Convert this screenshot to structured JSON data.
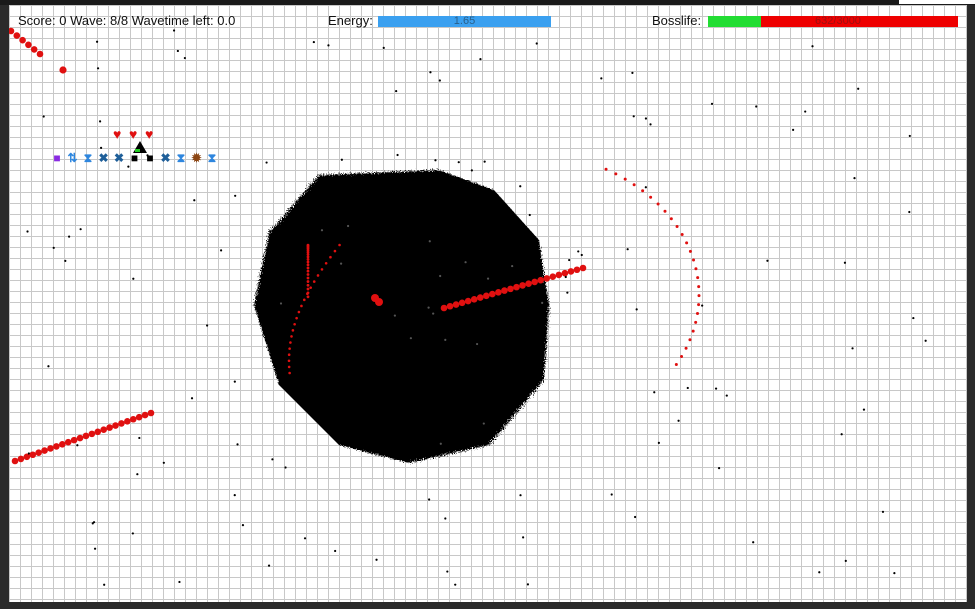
{
  "hud": {
    "score_label": "Score:",
    "score_value": "0",
    "wave_label": "Wave:",
    "wave_value": "8/8",
    "wavetime_label": "Wavetime left:",
    "wavetime_value": "0.0",
    "energy_label": "Energy:",
    "energy_value": "1.65",
    "energy_fill_fraction": 1.0,
    "bosslife_label": "Bosslife:",
    "bosslife_value": "632/3000",
    "bosslife_fraction": 0.2107
  },
  "lives": {
    "count": 3
  },
  "inventory": {
    "items": [
      {
        "icon": "purple-square-icon",
        "color": "#8a2be2"
      },
      {
        "icon": "double-arrow-icon",
        "color": "#2e86de"
      },
      {
        "icon": "hourglass-icon",
        "color": "#2e86de"
      },
      {
        "icon": "cross-icon",
        "color": "#1f5f99"
      },
      {
        "icon": "cross-icon",
        "color": "#1f5f99"
      },
      {
        "icon": "black-square-icon",
        "color": "#000000"
      },
      {
        "icon": "black-square-icon",
        "color": "#000000"
      },
      {
        "icon": "cross-icon",
        "color": "#1f5f99"
      },
      {
        "icon": "hourglass-icon",
        "color": "#2e86de"
      },
      {
        "icon": "spiky-mine-icon",
        "color": "#8b4513"
      },
      {
        "icon": "hourglass-icon",
        "color": "#2e86de"
      }
    ]
  },
  "colors": {
    "energy_bar": "#3aa0f0",
    "boss_healthy": "#22dd33",
    "boss_damage": "#ee0000",
    "projectile": "#e01010",
    "boss_body": "#000000",
    "player": "#000000"
  }
}
